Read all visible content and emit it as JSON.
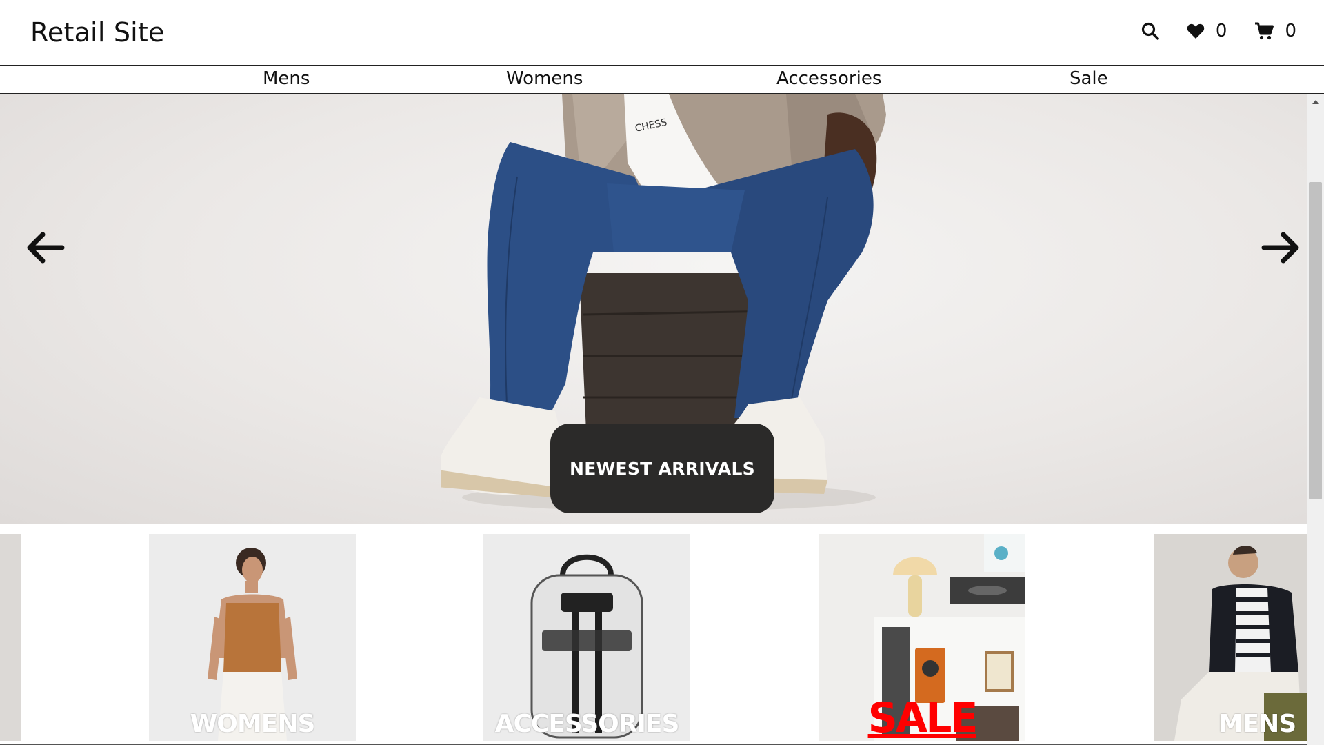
{
  "header": {
    "logo": "Retail Site",
    "wishlist_count": "0",
    "cart_count": "0",
    "icons": [
      "search-icon",
      "heart-icon",
      "cart-icon"
    ]
  },
  "nav": {
    "items": [
      {
        "label": "Mens"
      },
      {
        "label": "Womens"
      },
      {
        "label": "Accessories"
      },
      {
        "label": "Sale"
      }
    ]
  },
  "hero": {
    "cta_label": "NEWEST ARRIVALS",
    "shirt_print": "CHESS",
    "icons": [
      "arrow-left-icon",
      "arrow-right-icon"
    ]
  },
  "categories": [
    {
      "label": "WOMENS"
    },
    {
      "label": "ACCESSORIES"
    },
    {
      "label": "SALE"
    },
    {
      "label": "MENS"
    }
  ],
  "colors": {
    "cta_bg": "#2b2a29",
    "sale_red": "#ff0000",
    "denim": "#2c4f86"
  }
}
